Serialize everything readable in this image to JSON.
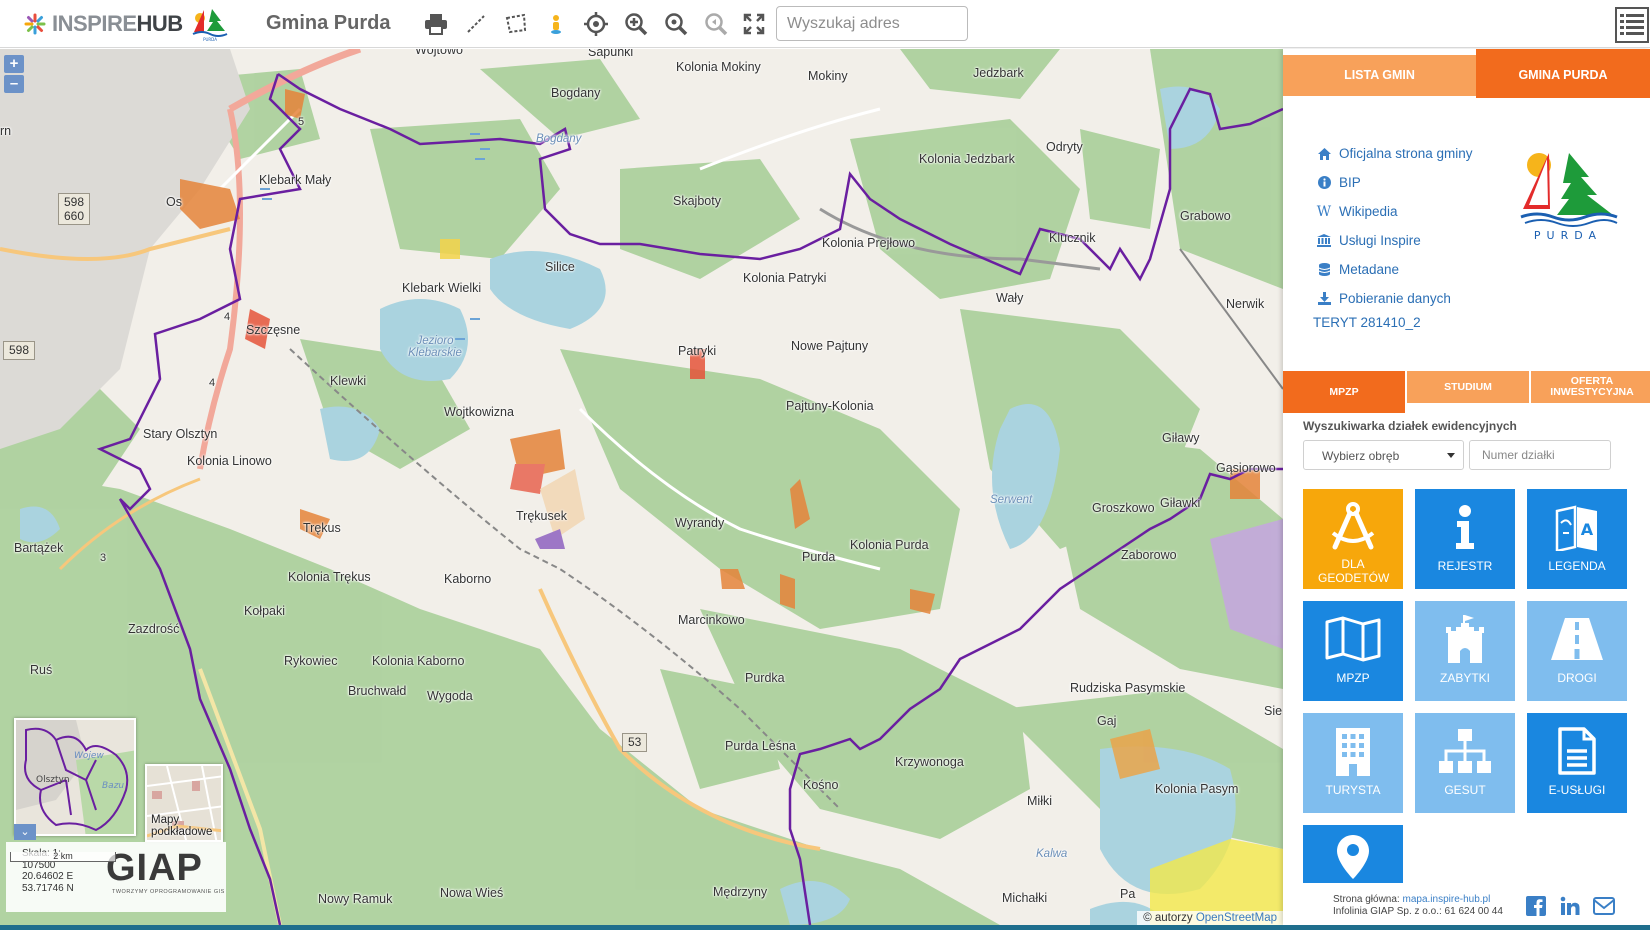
{
  "header": {
    "logo_inspire": "INSPIRE",
    "logo_hub": "HUB",
    "title": "Gmina Purda",
    "search_placeholder": "Wyszukaj adres"
  },
  "toolbar": {
    "tools": [
      "print-icon",
      "measure-line-icon",
      "measure-area-icon",
      "streetview-person-icon",
      "locate-icon",
      "zoom-in-icon",
      "zoom-extent-icon",
      "zoom-previous-icon",
      "fullscreen-icon"
    ]
  },
  "map": {
    "zoom_in": "+",
    "zoom_out": "–",
    "labels": {
      "wojtowo": "Wójtowo",
      "sapunki": "Sapunki",
      "kolonia_mokiny": "Kolonia Mokiny",
      "jedzbark": "Jedzbark",
      "bogdany": "Bogdany",
      "mokiny": "Mokiny",
      "odryty": "Odryty",
      "kolonia_jedzbark": "Kolonia Jedzbark",
      "klebark_maly": "Klebark Mały",
      "skajboty": "Skajboty",
      "grabowo": "Grabowo",
      "klucznik": "Klucznik",
      "kolonia_prejlowo": "Kolonia Prejłowo",
      "silice": "Silice",
      "kolonia_patryki": "Kolonia Patryki",
      "waly": "Wały",
      "klebark_wielki": "Klebark Wielki",
      "nerwik": "Nerwik",
      "szczesne": "Szczęsne",
      "patryki": "Patryki",
      "nowe_pajtuny": "Nowe Pajtuny",
      "klewki": "Klewki",
      "pajtuny_kolonia": "Pajtuny-Kolonia",
      "wojtkowizna": "Wojtkowizna",
      "stary_olsztyn": "Stary Olsztyn",
      "kolonia_linowo": "Kolonia Linowo",
      "gilawy": "Giławy",
      "gasiorowo": "Gąsiorowo",
      "trekus": "Trękus",
      "trekusek": "Trękusek",
      "wyrandy": "Wyrandy",
      "groszkowo": "Groszkowo",
      "gilawki": "Giławki",
      "bartazek": "Bartążek",
      "purda": "Purda",
      "kolonia_purda": "Kolonia Purda",
      "zaborowo": "Zaborowo",
      "kolonia_trekus": "Kolonia Trękus",
      "kaborno": "Kaborno",
      "kolpaki": "Kołpaki",
      "marcinkowo": "Marcinkowo",
      "zazdrosc": "Zazdrość",
      "rykowiec": "Rykowiec",
      "kolonia_kaborno": "Kolonia Kaborno",
      "rus": "Ruś",
      "purdka": "Purdka",
      "bruchwald": "Bruchwałd",
      "wygoda": "Wygoda",
      "rudziska": "Rudziska Pasymskie",
      "gaj": "Gaj",
      "purda_lesna": "Purda Leśna",
      "krzywonoga": "Krzywonoga",
      "kosno": "Kośno",
      "kolonia_pasym": "Kolonia Pasym",
      "milki": "Miłki",
      "nowy_ramuk": "Nowy Ramuk",
      "nowa_wies": "Nowa Wieś",
      "medrzyny": "Mędrzyny",
      "michalki": "Michałki",
      "pa": "Pa",
      "sie": "Sie",
      "rn": "rn",
      "os": "Os",
      "jezioro_klebarskie": "Jezioro Klebarskie",
      "serwent": "Serwent",
      "kalwa": "Kalwa",
      "bogdany_water": "Bogdany"
    },
    "road_shields": {
      "r598a": "598",
      "r660": "660",
      "r598b": "598",
      "r53": "53",
      "r5": "5",
      "r4a": "4",
      "r4b": "4",
      "r3": "3"
    },
    "basemap_label": "Mapy podkładowe",
    "scale_label": "Skala: 1:",
    "scale_value": "107500",
    "coord_e": "20.64602 E",
    "coord_n": "53.71746 N",
    "giap": "GIAP",
    "giap_sub": "TWORZYMY OPROGRAMOWANIE GIS",
    "scalebar": "2 km",
    "attribution_prefix": "© autorzy",
    "attribution_link": "OpenStreetMap"
  },
  "panel": {
    "tab_lista": "LISTA GMIN",
    "tab_gmina": "GMINA PURDA",
    "links": [
      {
        "label": "Oficjalna strona gminy",
        "icon": "home-icon"
      },
      {
        "label": "BIP",
        "icon": "info-icon"
      },
      {
        "label": "Wikipedia",
        "icon": "wikipedia-icon"
      },
      {
        "label": "Usługi Inspire",
        "icon": "institution-icon"
      },
      {
        "label": "Metadane",
        "icon": "database-icon"
      },
      {
        "label": "Pobieranie danych",
        "icon": "download-icon"
      }
    ],
    "teryt": "TERYT 281410_2",
    "logo_text": "PURDA",
    "tab_mpzp": "MPZP",
    "tab_studium": "STUDIUM",
    "tab_oferta": "OFERTA INWESTYCYJNA",
    "search_title": "Wyszukiwarka działek ewidencyjnych",
    "obreb_placeholder": "Wybierz obręb",
    "numer_placeholder": "Numer działki",
    "tiles": [
      {
        "label": "DLA GEODETÓW",
        "icon": "compass-icon",
        "color": "#f7a70b"
      },
      {
        "label": "REJESTR",
        "icon": "info-icon",
        "color": "#1a87e0"
      },
      {
        "label": "LEGENDA",
        "icon": "map-legend-icon",
        "color": "#1a87e0"
      },
      {
        "label": "MPZP",
        "icon": "map-icon",
        "color": "#1a87e0"
      },
      {
        "label": "ZABYTKI",
        "icon": "castle-icon",
        "color": "#7fbdee"
      },
      {
        "label": "DROGI",
        "icon": "road-icon",
        "color": "#7fbdee"
      },
      {
        "label": "TURYSTA",
        "icon": "building-icon",
        "color": "#7fbdee"
      },
      {
        "label": "GESUT",
        "icon": "network-icon",
        "color": "#7fbdee"
      },
      {
        "label": "E-USŁUGI",
        "icon": "document-icon",
        "color": "#1a87e0"
      },
      {
        "label": "",
        "icon": "map-marker-icon",
        "color": "#1a87e0"
      }
    ],
    "footer_line1_prefix": "Strona główna:",
    "footer_line1_link": "mapa.inspire-hub.pl",
    "footer_line2": "Infolinia GIAP Sp. z o.o.: 61 624 00 44",
    "social": [
      "facebook-icon",
      "linkedin-icon",
      "email-icon"
    ]
  },
  "colors": {
    "accent_orange": "#f26b1d",
    "light_orange": "#f8a15a",
    "tile_blue": "#1a87e0",
    "tile_light_blue": "#7fbdee",
    "boundary": "#6a1fa0"
  }
}
